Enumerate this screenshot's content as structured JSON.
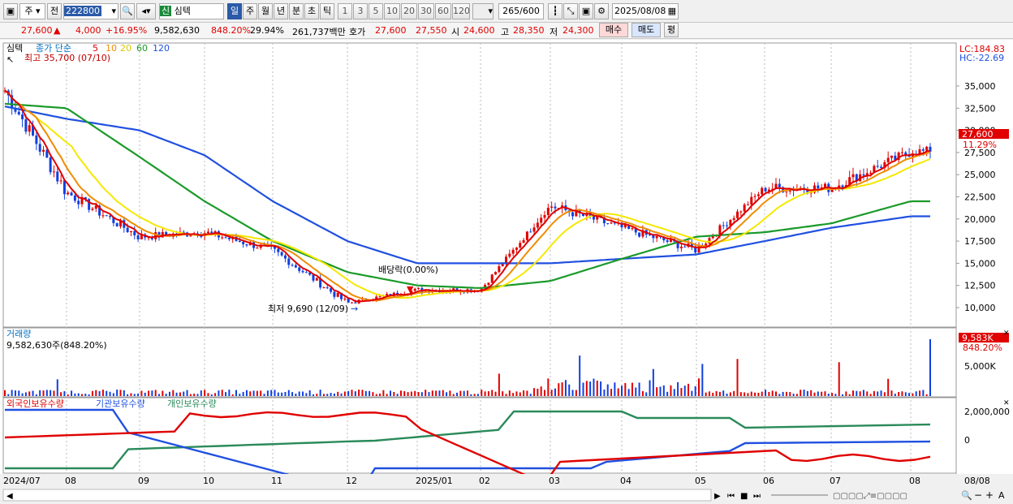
{
  "toolbar": {
    "left_icon": "window-icon",
    "market": "주",
    "tab_prev": "전",
    "code": "222800",
    "stock_name": "심텍",
    "sin_badge": "신",
    "period_buttons": [
      "일",
      "주",
      "월",
      "년",
      "분",
      "초",
      "틱"
    ],
    "intervals": [
      "1",
      "3",
      "5",
      "10",
      "20",
      "30",
      "60",
      "120"
    ],
    "count": "265",
    "count_max": "/600",
    "date": "2025/08/08"
  },
  "quote": {
    "price": "27,600",
    "arrow": "▲",
    "change": "4,000",
    "change_pct": "+16.95%",
    "volume": "9,582,630",
    "vol_ratio": "848.20%",
    "turnover": "29.94%",
    "amount": "261,737백만",
    "hoga_label": "호가",
    "bid": "27,600",
    "ask": "27,550",
    "open_label": "시",
    "open": "24,600",
    "high_label": "고",
    "high": "28,350",
    "low_label": "저",
    "low": "24,300",
    "buy_button": "매수",
    "sell_button": "매도",
    "avg_button": "평"
  },
  "price_panel": {
    "legend_name": "심텍",
    "legend_ma": "종가 단순",
    "ma_periods": [
      "5",
      "10",
      "20",
      "60",
      "120"
    ],
    "ma_colors": [
      "#e00000",
      "#f08c00",
      "#f5e800",
      "#1a9a2a",
      "#2050e0"
    ],
    "high_note": "최고 35,700 (07/10)",
    "low_note": "최저 9,690 (12/09)",
    "div_note": "배당락(0.00%)",
    "lc": "LC:184.83",
    "hc": "HC:-22.69",
    "current_price": "27,600",
    "current_pct": "11.29%",
    "y_ticks": [
      "35,000",
      "32,500",
      "30,000",
      "27,500",
      "25,000",
      "22,500",
      "20,000",
      "17,500",
      "15,000",
      "12,500",
      "10,000"
    ]
  },
  "volume_panel": {
    "title": "거래량",
    "subtitle": "9,582,630주(848.20%)",
    "tick": "5,000K",
    "current": "9,583K",
    "current_pct": "848.20%"
  },
  "holding_panel": {
    "series": [
      "외국인보유수량",
      "기관보유수량",
      "개인보유수량"
    ],
    "colors": [
      "#e00000",
      "#2050e0",
      "#2a8a5a"
    ],
    "ticks": [
      "2,000,000",
      "0"
    ]
  },
  "x_axis": {
    "labels": [
      "2024/07",
      "08",
      "09",
      "10",
      "11",
      "12",
      "2025/01",
      "02",
      "03",
      "04",
      "05",
      "06",
      "07",
      "08"
    ],
    "right_label": "08/08"
  },
  "chart_data": {
    "type": "candlestick",
    "x": [
      "2024/07",
      "08",
      "09",
      "10",
      "11",
      "12",
      "2025/01",
      "02",
      "03",
      "04",
      "05",
      "06",
      "07",
      "08"
    ],
    "close_approx": [
      34500,
      23000,
      18000,
      18500,
      16500,
      10500,
      12000,
      12000,
      21500,
      19000,
      16500,
      23500,
      23500,
      27600
    ],
    "ma120_approx": [
      32700,
      31300,
      30000,
      27200,
      22000,
      17500,
      15000,
      15000,
      15000,
      15500,
      16000,
      17500,
      19000,
      20300
    ],
    "ma60_approx": [
      33000,
      32500,
      27000,
      22000,
      17500,
      14000,
      12500,
      12200,
      13000,
      15500,
      18000,
      18500,
      19500,
      22000
    ],
    "high": 35700,
    "low": 9690,
    "last": 27600,
    "y_range": [
      9000,
      36500
    ]
  }
}
